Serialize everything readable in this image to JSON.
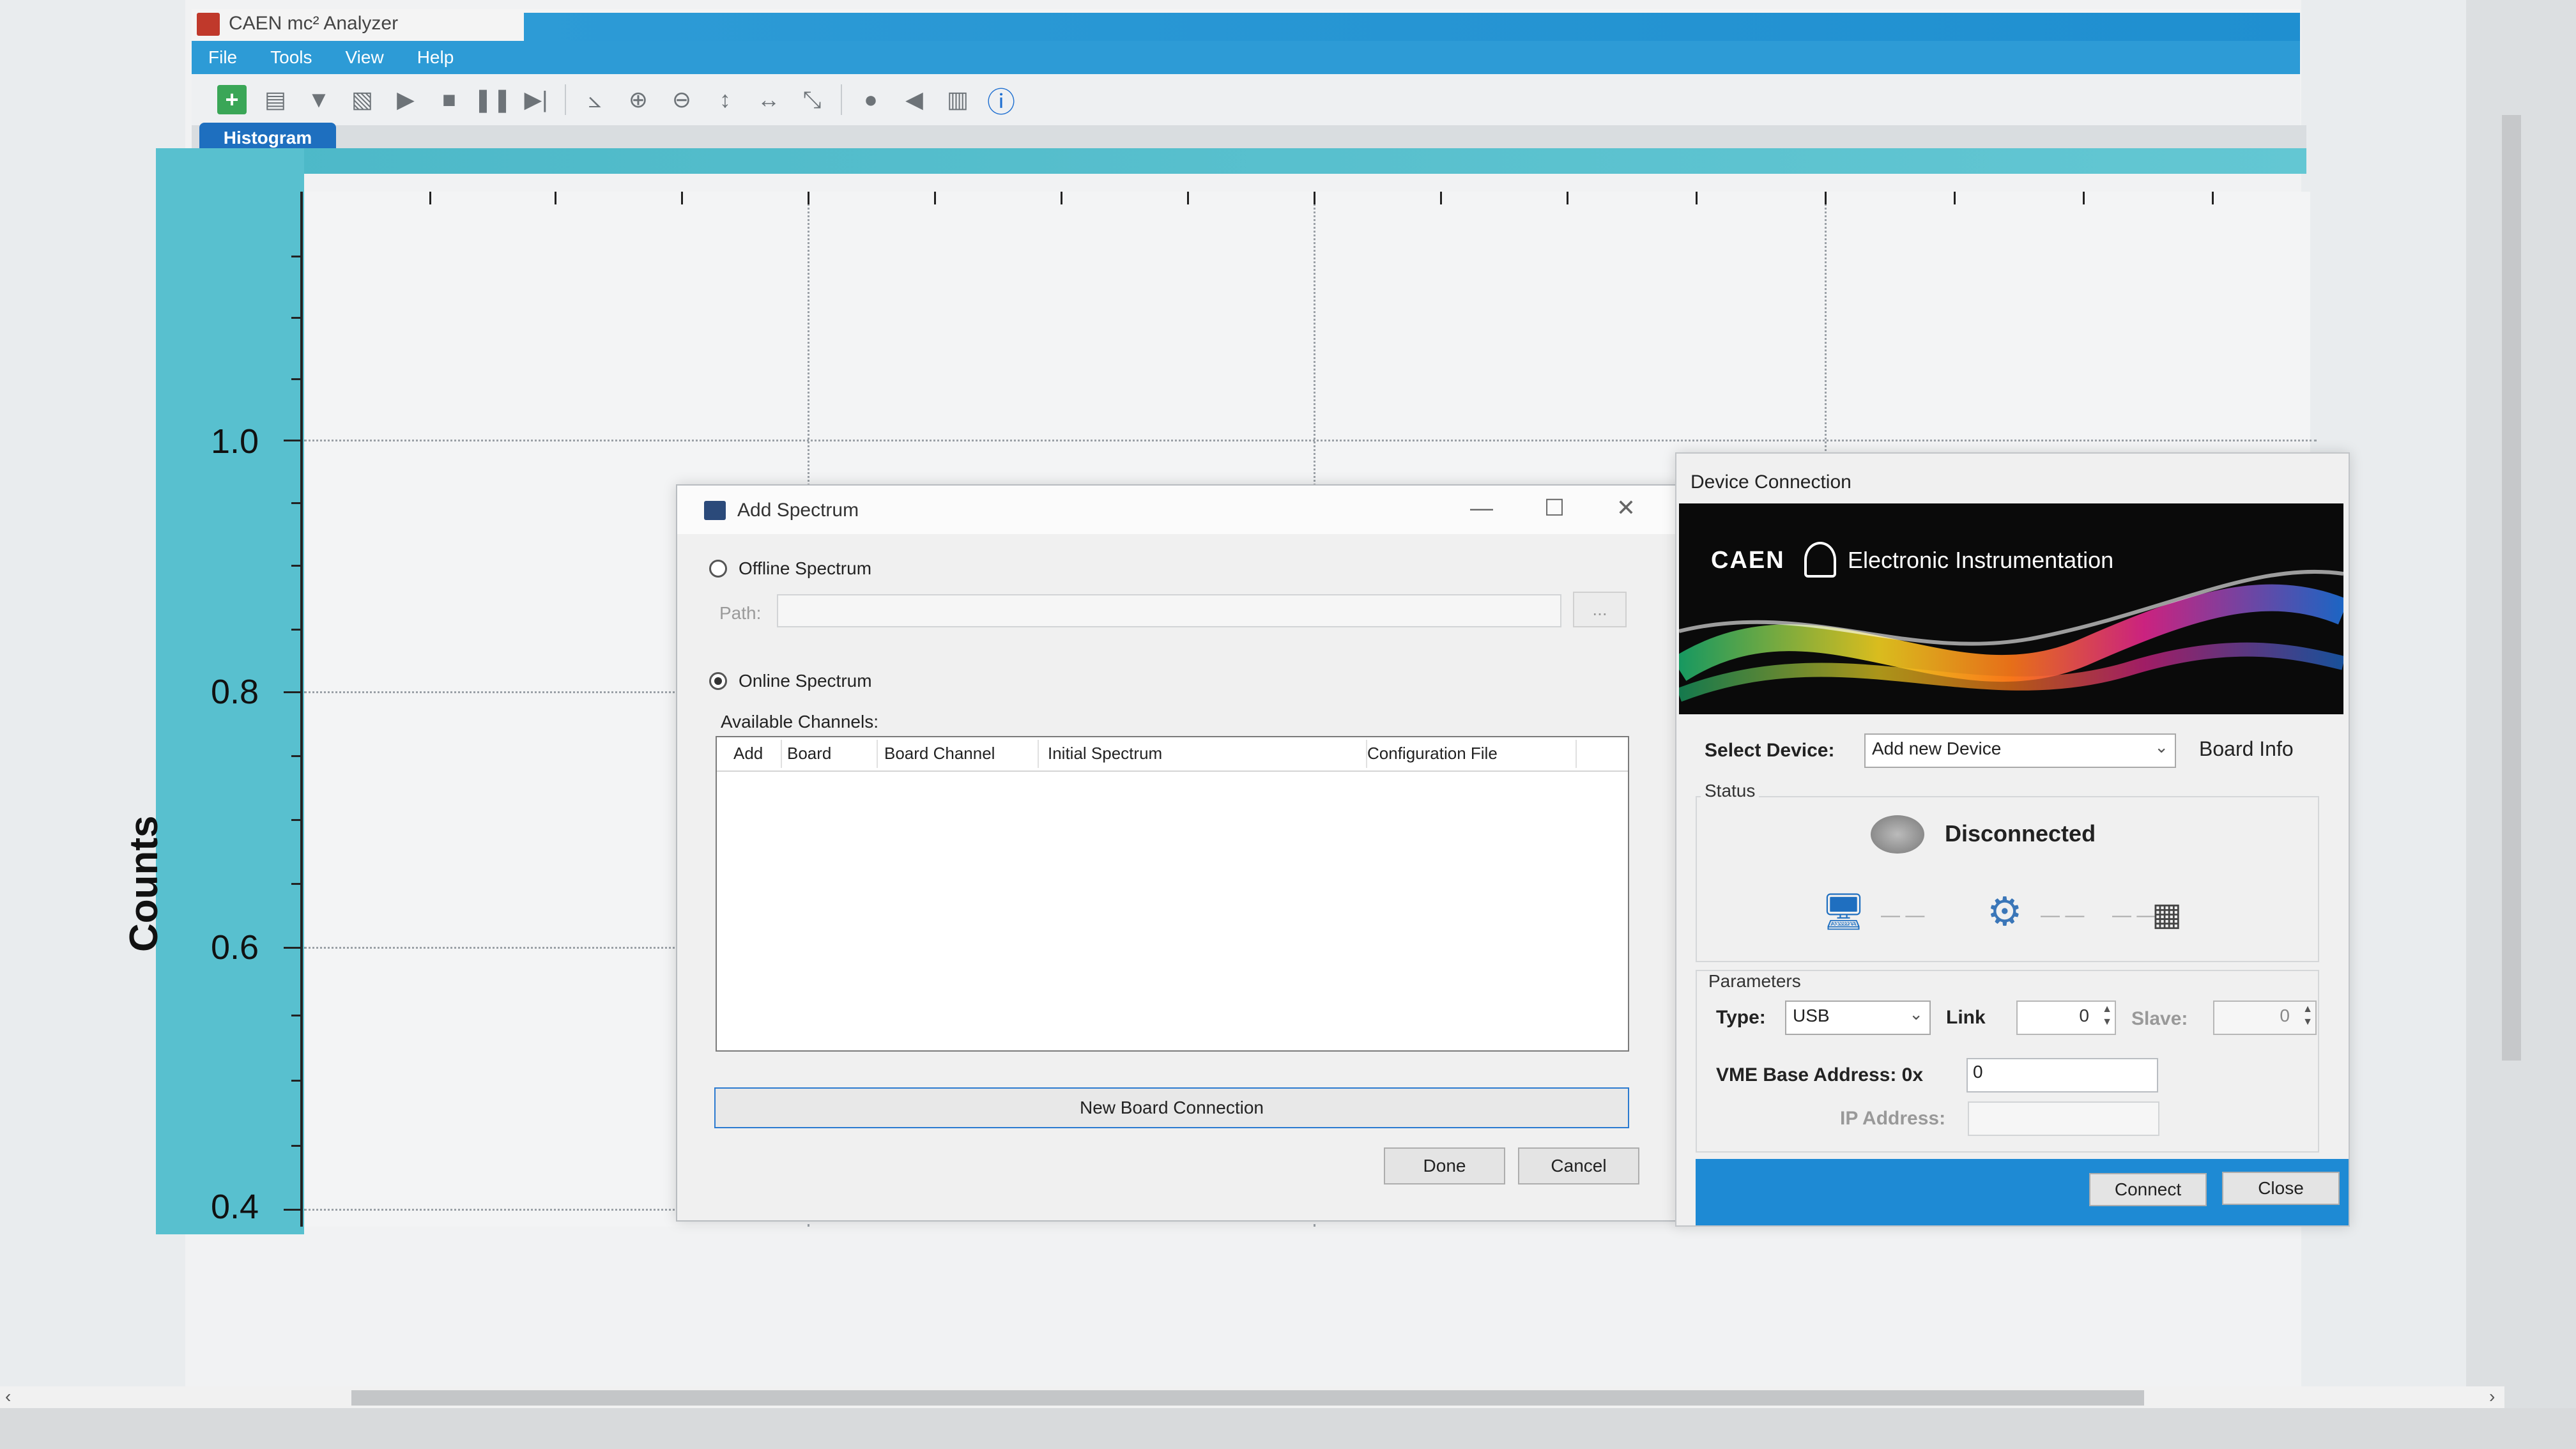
{
  "window": {
    "title": "CAEN mc² Analyzer"
  },
  "menu": [
    "File",
    "Tools",
    "View",
    "Help"
  ],
  "toolbar": {
    "icons": [
      "add-icon",
      "save-icon",
      "probe-icon",
      "export-icon",
      "play-icon",
      "stop-icon",
      "pause-icon",
      "step-icon",
      "axis-icon",
      "zoom-in-icon",
      "zoom-out-icon",
      "vertical-scale-icon",
      "horizontal-scale-icon",
      "reset-icon",
      "globe-icon",
      "back-icon",
      "chart-icon",
      "info-icon"
    ]
  },
  "tabs": {
    "histogram": "Histogram"
  },
  "plot": {
    "y_axis_title": "Counts",
    "y_tick_labels": [
      "1.0",
      "0.8",
      "0.6",
      "0.4"
    ]
  },
  "add_spectrum": {
    "title": "Add Spectrum",
    "offline_label": "Offline Spectrum",
    "path_label": "Path:",
    "path_value": "",
    "browse_label": "...",
    "online_label": "Online Spectrum",
    "available_channels_label": "Available Channels:",
    "columns": [
      "Add",
      "Board",
      "Board Channel",
      "Initial Spectrum",
      "Configuration File"
    ],
    "new_board_button": "New Board Connection",
    "done_button": "Done",
    "cancel_button": "Cancel",
    "selected_mode": "online"
  },
  "device_connection": {
    "title": "Device Connection",
    "banner_brand": "CAEN",
    "banner_text": "Electronic Instrumentation",
    "select_device_label": "Select Device:",
    "select_device_value": "Add new Device",
    "board_info_label": "Board Info",
    "status_group": "Status",
    "status_text": "Disconnected",
    "parameters_group": "Parameters",
    "type_label": "Type:",
    "type_value": "USB",
    "link_label": "Link",
    "link_value": "0",
    "slave_label": "Slave:",
    "slave_value": "0",
    "vme_label": "VME Base Address: 0x",
    "vme_value": "0",
    "ip_label": "IP Address:",
    "ip_value": "",
    "connect_button": "Connect",
    "close_button": "Close"
  },
  "colors": {
    "accent": "#2d9bd6",
    "plot_band": "#58c0cf",
    "footer": "#1e8ad4"
  }
}
